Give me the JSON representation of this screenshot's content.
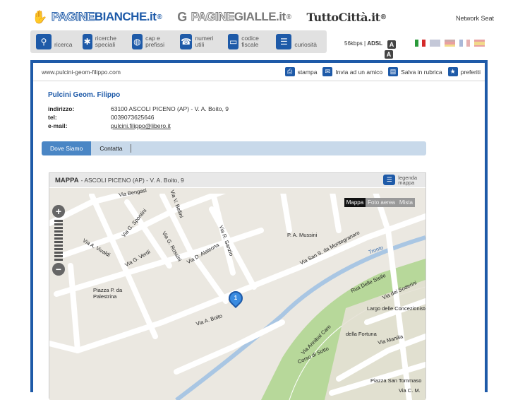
{
  "header": {
    "logo_pb_a": "PAGINE",
    "logo_pb_b": "BIANCHE.it",
    "logo_pg_a": "PAGINE",
    "logo_pg_b": "GIALLE.it",
    "logo_tc": "TuttoCittà.it",
    "reg_mark": "®",
    "network": "Network Seat"
  },
  "toolbar": {
    "items": [
      {
        "label": "ricerca"
      },
      {
        "label": "ricerche speciali"
      },
      {
        "label": "cap e prefissi"
      },
      {
        "label": "numeri utili"
      },
      {
        "label": "codice fiscale"
      },
      {
        "label": "curiosità"
      }
    ],
    "connection": "56kbps",
    "adsl": "ADSL",
    "badge": "A"
  },
  "address_bar": {
    "url": "www.pulcini-geom-filippo.com",
    "actions": [
      "stampa",
      "Invia ad un amico",
      "Salva in rubrica",
      "preferiti"
    ]
  },
  "business": {
    "name": "Pulcini Geom. Filippo",
    "fields": [
      {
        "key": "indirizzo:",
        "value": "63100 ASCOLI PICENO (AP) - V. A. Boito, 9"
      },
      {
        "key": "tel:",
        "value": "0039073625646"
      },
      {
        "key": "e-mail:",
        "value": "pulcini.filippo@libero.it"
      }
    ]
  },
  "tabs": [
    "Dove Siamo",
    "Contatta"
  ],
  "map": {
    "title": "MAPPA",
    "subtitle": "- ASCOLI PICENO (AP) - V. A. Boito, 9",
    "legend_a": "legenda",
    "legend_b": "mappa",
    "types": [
      "Mappa",
      "Foto aerea",
      "Mista"
    ],
    "marker": "1",
    "labels": [
      "Via Bengasi",
      "Via V. Bellini",
      "Via G. Spontini",
      "Via G. Rossini",
      "Via G. Verdi",
      "Via A. Vivaldi",
      "Via D. Alaleona",
      "Via R. Sanzio",
      "P. A. Mussini",
      "Via San S. da Montegranaro",
      "Tronto",
      "Piazza P. da Palestrina",
      "Via A. Boito",
      "Rua Delle Stelle",
      "Via dei Soderini",
      "Largo delle Concezioniste",
      "della Fortuna",
      "Via Manilia",
      "Via Annibal Caro",
      "Corso di Sotto",
      "Piazza San Tommaso",
      "Via C. M."
    ]
  },
  "colors": {
    "brand": "#1e5aa8",
    "tab_active": "#4a86c5",
    "green": "#b7d89a"
  }
}
